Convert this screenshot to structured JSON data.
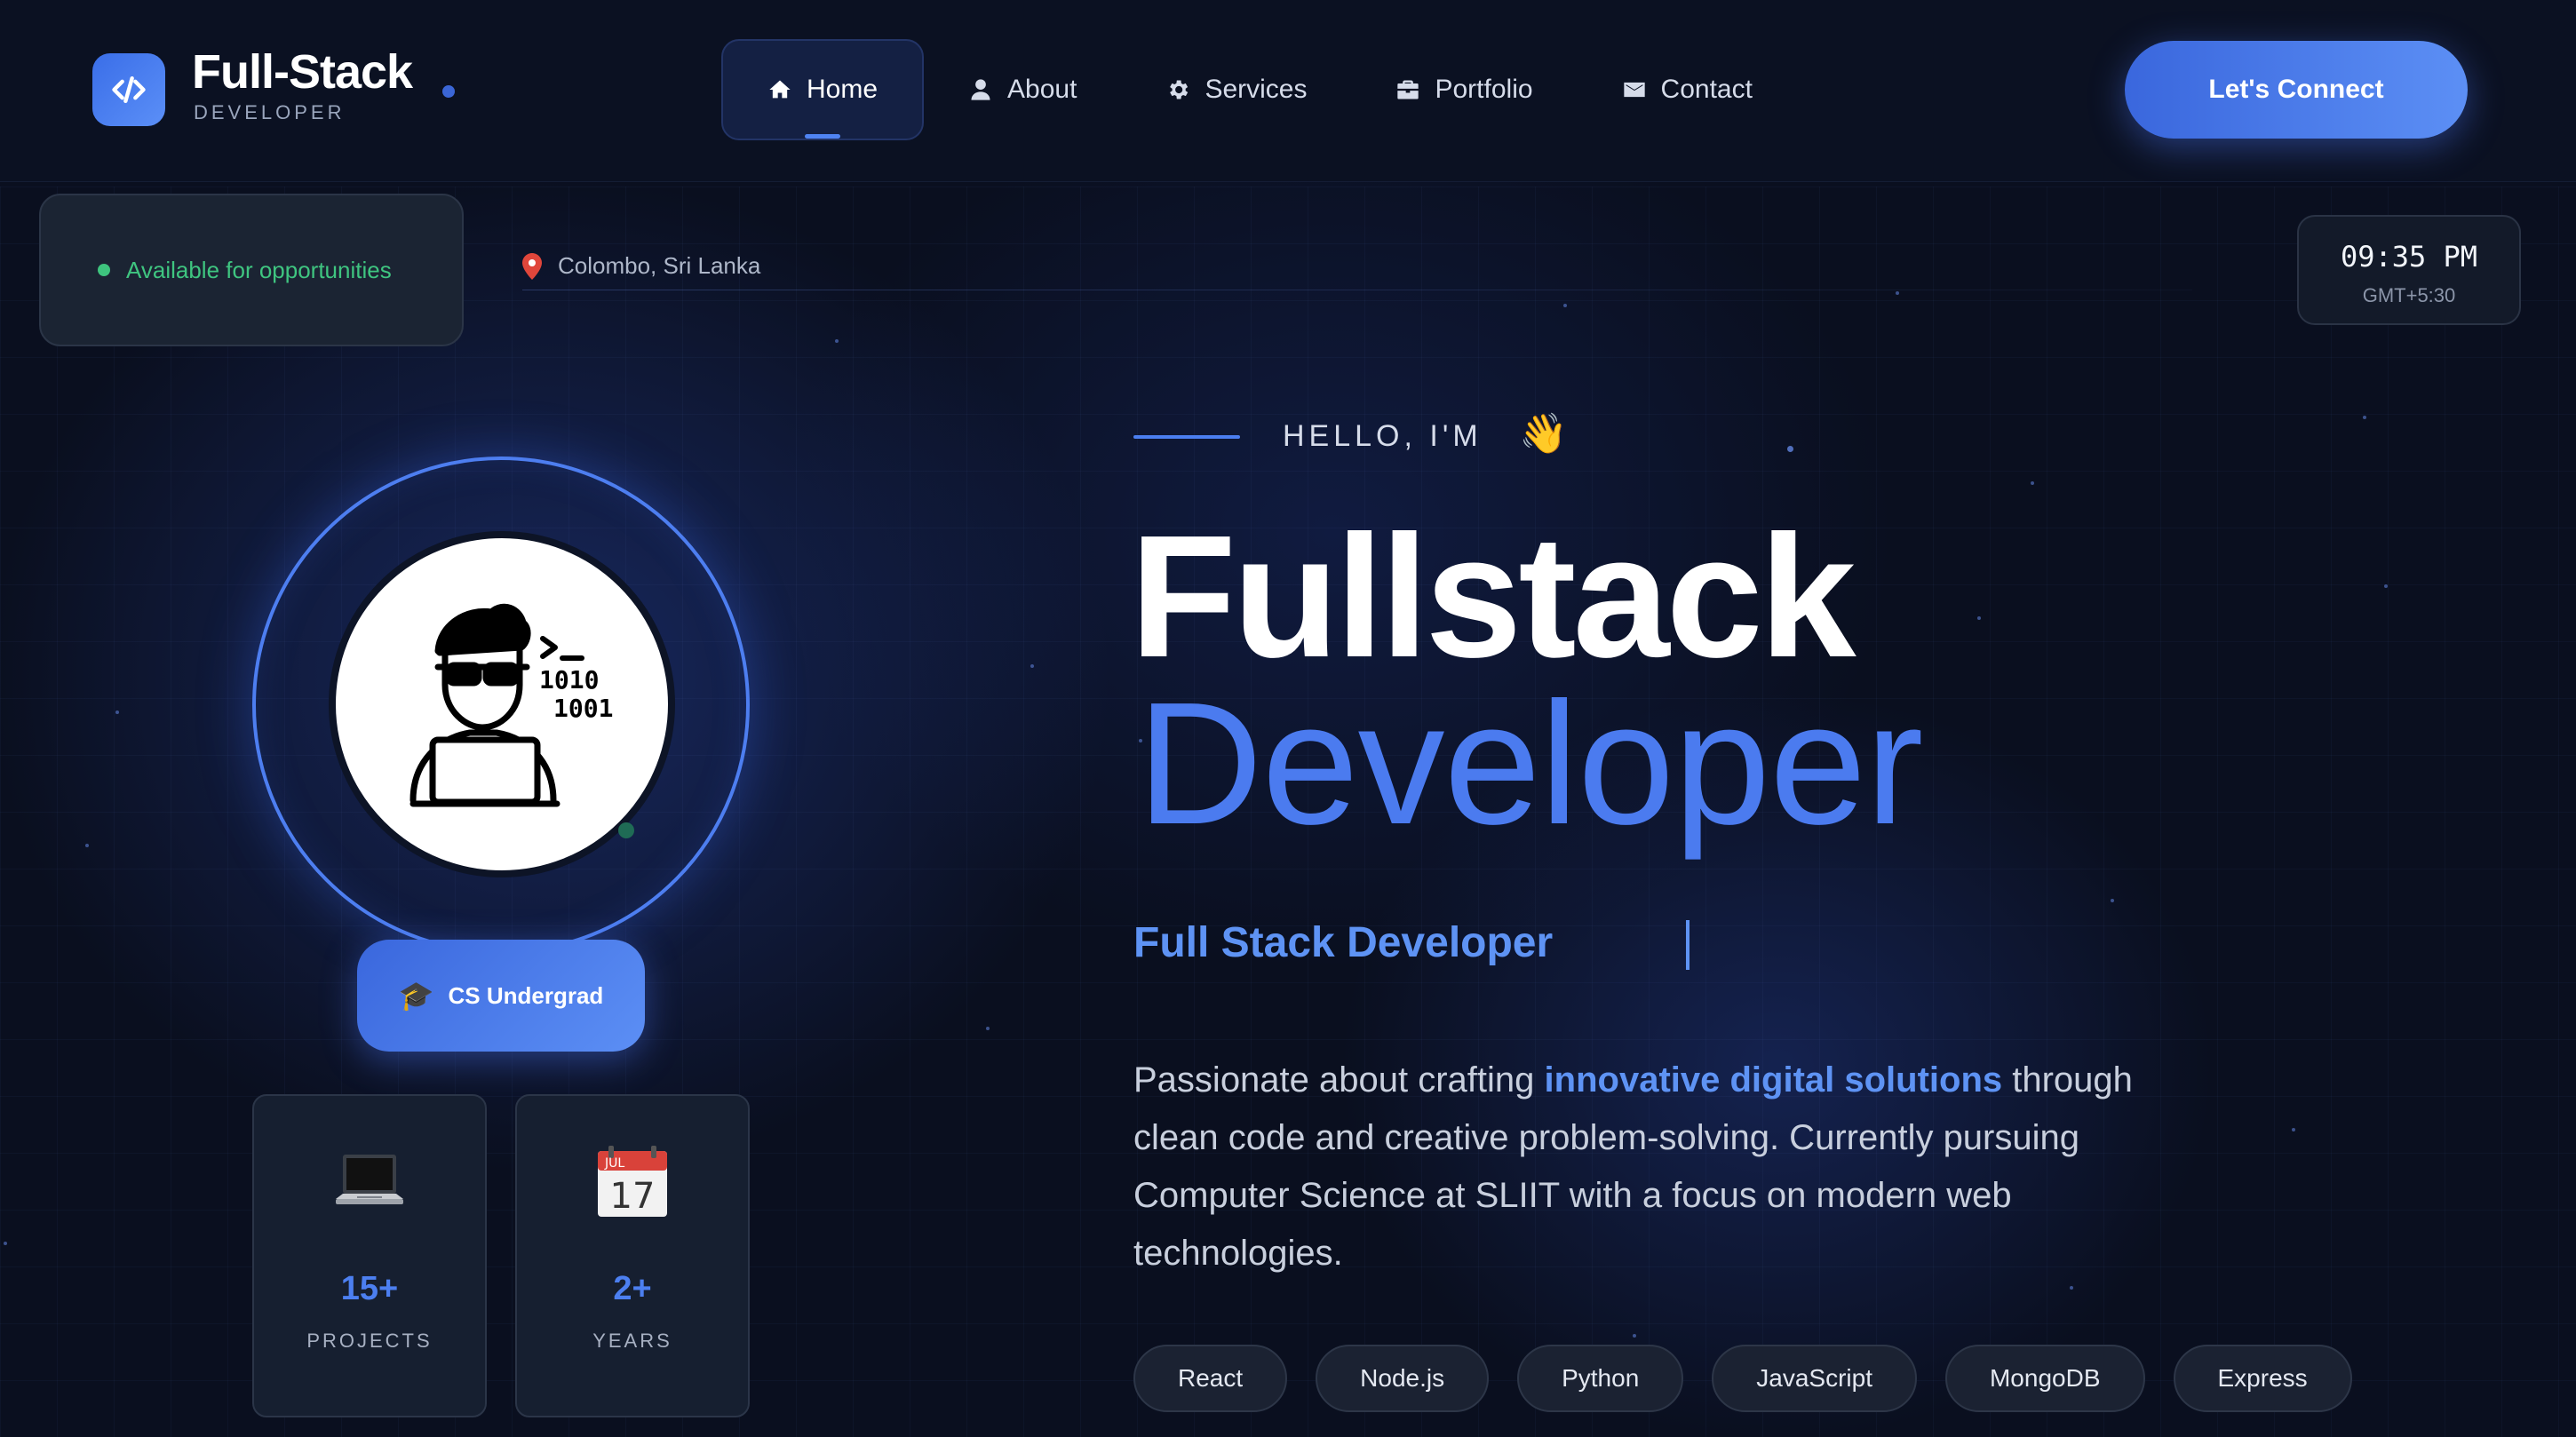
{
  "brand": {
    "title": "Full-Stack",
    "subtitle": "DEVELOPER"
  },
  "nav": {
    "items": [
      {
        "label": "Home",
        "icon": "home-icon",
        "active": true
      },
      {
        "label": "About",
        "icon": "user-icon"
      },
      {
        "label": "Services",
        "icon": "gear-icon"
      },
      {
        "label": "Portfolio",
        "icon": "briefcase-icon"
      },
      {
        "label": "Contact",
        "icon": "envelope-icon"
      }
    ],
    "cta": "Let's Connect"
  },
  "status": {
    "availability": "Available for opportunities",
    "location": "Colombo, Sri Lanka",
    "time": "09:35 PM",
    "timezone": "GMT+5:30"
  },
  "profile": {
    "badge": "CS Undergrad",
    "stats": [
      {
        "value": "15+",
        "label": "PROJECTS",
        "icon": "laptop-icon"
      },
      {
        "value": "2+",
        "label": "YEARS",
        "icon": "calendar-icon",
        "calendar_month": "JUL",
        "calendar_day": "17"
      }
    ]
  },
  "hero": {
    "greeting": "HELLO, I'M",
    "wave": "👋",
    "title_line1": "Fullstack",
    "title_line2": "Developer",
    "role": "Full Stack Developer",
    "description_before": "Passionate about crafting ",
    "description_highlight": "innovative digital solutions",
    "description_after": " through clean code and creative problem-solving. Currently pursuing Computer Science at SLIIT with a focus on modern web technologies.",
    "skills": [
      "React",
      "Node.js",
      "Python",
      "JavaScript",
      "MongoDB",
      "Express"
    ]
  },
  "colors": {
    "background": "#0a0f1f",
    "accent": "#4b7bef",
    "available_green": "#3fc580"
  }
}
